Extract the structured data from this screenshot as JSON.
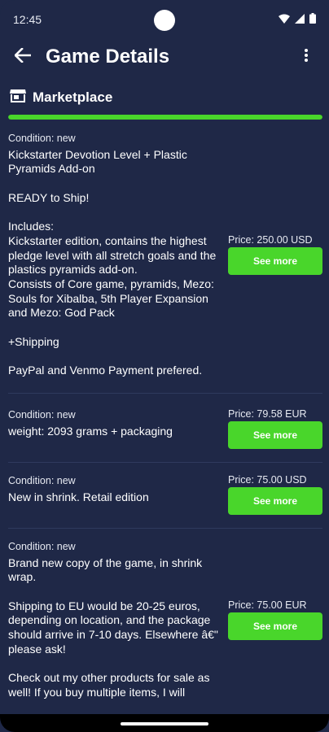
{
  "status_bar": {
    "time": "12:45"
  },
  "app_bar": {
    "title": "Game Details"
  },
  "section": {
    "title": "Marketplace",
    "progress": 1.0
  },
  "listings": [
    {
      "condition": "Condition: new",
      "description": "Kickstarter Devotion Level + Plastic Pyramids Add-on\n\nREADY to Ship!\n\nIncludes:\nKickstarter edition, contains the highest pledge level with all stretch goals and the plastics pyramids add-on.\nConsists of Core game, pyramids, Mezo: Souls for Xibalba, 5th Player Expansion and Mezo: God Pack\n\n+Shipping\n\nPayPal and Venmo Payment prefered.",
      "price": "Price: 250.00 USD",
      "button": "See more"
    },
    {
      "condition": "Condition: new",
      "description": "weight: 2093 grams + packaging",
      "price": "Price: 79.58 EUR",
      "button": "See more"
    },
    {
      "condition": "Condition: new",
      "description": "New in shrink. Retail edition",
      "price": "Price: 75.00 USD",
      "button": "See more"
    },
    {
      "condition": "Condition: new",
      "description": "Brand new copy of the game, in shrink wrap.\n\nShipping to EU would be 20-25 euros, depending on location, and the package should arrive in 7-10 days. Elsewhere â€\" please ask!\n\nCheck out my other products for sale as well! If you buy multiple items, I will",
      "price": "Price: 75.00 EUR",
      "button": "See more"
    }
  ],
  "icons": {
    "back": "arrow-left-icon",
    "menu": "more-vertical-icon",
    "section": "store-icon",
    "wifi": "wifi-icon",
    "signal": "signal-icon",
    "battery": "battery-icon"
  },
  "colors": {
    "background": "#1f2847",
    "accent": "#49d62b",
    "divider": "#2f3a5e"
  }
}
